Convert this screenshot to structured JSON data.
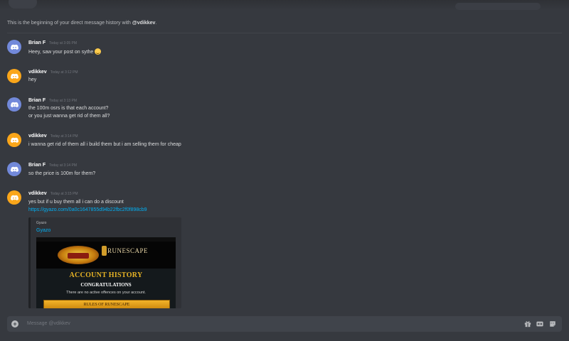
{
  "intro": {
    "prefix": "This is the beginning of your direct message history with ",
    "username": "@vdikkev",
    "suffix": "."
  },
  "messages": [
    {
      "author": "Brian F",
      "timestamp": "Today at 3:05 PM",
      "avatar_color": "#7289da",
      "lines": [
        "Heey, saw your post on sythe"
      ],
      "emoji": "smiley-icon"
    },
    {
      "author": "vdikkev",
      "timestamp": "Today at 3:12 PM",
      "avatar_color": "#faa61a",
      "lines": [
        "hey"
      ]
    },
    {
      "author": "Brian F",
      "timestamp": "Today at 3:13 PM",
      "avatar_color": "#7289da",
      "lines": [
        "the 100m osrs is that each account?",
        "or you just wanna get rid of them all?"
      ]
    },
    {
      "author": "vdikkev",
      "timestamp": "Today at 3:14 PM",
      "avatar_color": "#faa61a",
      "lines": [
        "i wanna get rid of them all i build them but i am selling them for cheap"
      ]
    },
    {
      "author": "Brian F",
      "timestamp": "Today at 3:14 PM",
      "avatar_color": "#7289da",
      "lines": [
        "so the price is 100m for them?"
      ]
    },
    {
      "author": "vdikkev",
      "timestamp": "Today at 3:15 PM",
      "avatar_color": "#faa61a",
      "lines": [
        "yes but if u buy them all i can do a discount"
      ],
      "link": "https://gyazo.com/0a0c1647855d94b22fbc2f0f898cb9"
    }
  ],
  "embed": {
    "provider": "Gyazo",
    "title": "Gyazo",
    "image": {
      "account_history": "ACCOUNT HISTORY",
      "congratulations": "CONGRATULATIONS",
      "no_offences": "There are no active offences on your account.",
      "rules_button": "RULES OF RUNESCAPE",
      "rs_logo": "RUNESCAPE"
    }
  },
  "composer": {
    "placeholder": "Message @vdikkev",
    "icons": [
      "plus-icon",
      "gift-icon",
      "gif-icon",
      "sticker-icon"
    ]
  }
}
